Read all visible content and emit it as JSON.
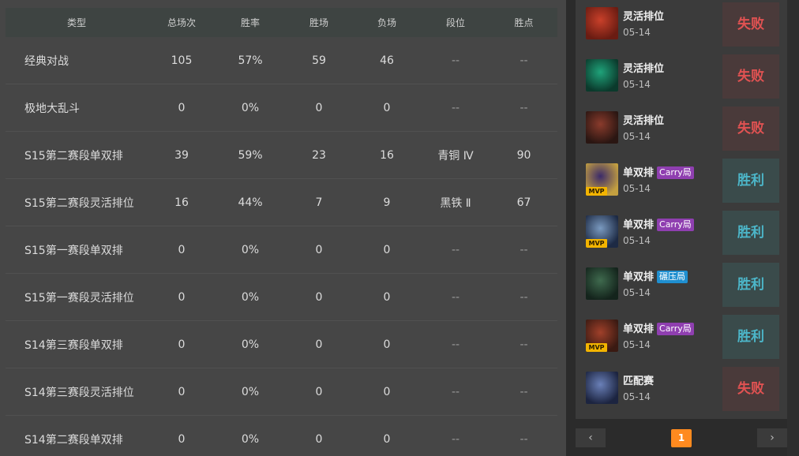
{
  "table": {
    "headers": {
      "type": "类型",
      "total": "总场次",
      "rate": "胜率",
      "win": "胜场",
      "loss": "负场",
      "rank": "段位",
      "points": "胜点"
    },
    "rows": [
      {
        "type": "经典对战",
        "total": "105",
        "rate": "57%",
        "win": "59",
        "loss": "46",
        "rank": "--",
        "points": "--"
      },
      {
        "type": "极地大乱斗",
        "total": "0",
        "rate": "0%",
        "win": "0",
        "loss": "0",
        "rank": "--",
        "points": "--"
      },
      {
        "type": "S15第二赛段单双排",
        "total": "39",
        "rate": "59%",
        "win": "23",
        "loss": "16",
        "rank": "青铜 Ⅳ",
        "points": "90"
      },
      {
        "type": "S15第二赛段灵活排位",
        "total": "16",
        "rate": "44%",
        "win": "7",
        "loss": "9",
        "rank": "黑铁 Ⅱ",
        "points": "67"
      },
      {
        "type": "S15第一赛段单双排",
        "total": "0",
        "rate": "0%",
        "win": "0",
        "loss": "0",
        "rank": "--",
        "points": "--"
      },
      {
        "type": "S15第一赛段灵活排位",
        "total": "0",
        "rate": "0%",
        "win": "0",
        "loss": "0",
        "rank": "--",
        "points": "--"
      },
      {
        "type": "S14第三赛段单双排",
        "total": "0",
        "rate": "0%",
        "win": "0",
        "loss": "0",
        "rank": "--",
        "points": "--"
      },
      {
        "type": "S14第三赛段灵活排位",
        "total": "0",
        "rate": "0%",
        "win": "0",
        "loss": "0",
        "rank": "--",
        "points": "--"
      },
      {
        "type": "S14第二赛段单双排",
        "total": "0",
        "rate": "0%",
        "win": "0",
        "loss": "0",
        "rank": "--",
        "points": "--"
      }
    ]
  },
  "matches": [
    {
      "mode": "灵活排位",
      "tag": "",
      "date": "05-14",
      "result": "失败",
      "mvp": "",
      "color_a": "#c9402a",
      "color_b": "#6a1c12"
    },
    {
      "mode": "灵活排位",
      "tag": "",
      "date": "05-14",
      "result": "失败",
      "mvp": "",
      "color_a": "#1fa37a",
      "color_b": "#0b3a2c"
    },
    {
      "mode": "灵活排位",
      "tag": "",
      "date": "05-14",
      "result": "失败",
      "mvp": "",
      "color_a": "#8a3b2c",
      "color_b": "#2a1612"
    },
    {
      "mode": "单双排",
      "tag": "Carry局",
      "date": "05-14",
      "result": "胜利",
      "mvp": "MVP",
      "color_a": "#3b2a6a",
      "color_b": "#c4a040"
    },
    {
      "mode": "单双排",
      "tag": "Carry局",
      "date": "05-14",
      "result": "胜利",
      "mvp": "MVP",
      "color_a": "#7a9ac0",
      "color_b": "#1d2a44"
    },
    {
      "mode": "单双排",
      "tag": "碾压局",
      "date": "05-14",
      "result": "胜利",
      "mvp": "",
      "color_a": "#3f6a4e",
      "color_b": "#14241c"
    },
    {
      "mode": "单双排",
      "tag": "Carry局",
      "date": "05-14",
      "result": "胜利",
      "mvp": "MVP",
      "color_a": "#a0402a",
      "color_b": "#3a1a12"
    },
    {
      "mode": "匹配赛",
      "tag": "",
      "date": "05-14",
      "result": "失败",
      "mvp": "",
      "color_a": "#6a80b8",
      "color_b": "#1c2440"
    }
  ],
  "pager": {
    "prev": "‹",
    "page": "1",
    "next": "›"
  }
}
